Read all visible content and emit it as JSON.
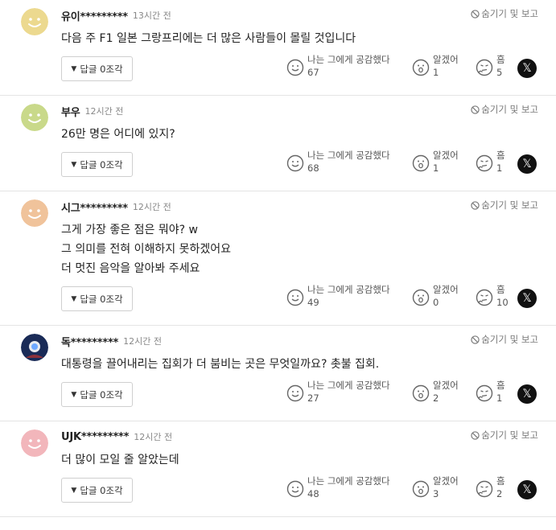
{
  "actions": {
    "hide_label": "숨기기 및 보고",
    "reply_label": "답글 0조각",
    "reaction_sympathy": "나는 그에게 공감했다",
    "reaction_understood": "알겠어",
    "reaction_hmm": "흠",
    "x_label": "𝕏"
  },
  "colors": {
    "avatar_yellow": "#ecd98f",
    "avatar_green": "#c9d98a",
    "avatar_orange": "#f0c39b",
    "avatar_pink": "#f2b6bb",
    "avatar_dark": "#1a2b57"
  },
  "comments": [
    {
      "author": "유이*********",
      "time": "13시간 전",
      "lines": [
        "다음 주 F1 일본 그랑프리에는 더 많은 사람들이 몰릴 것입니다"
      ],
      "sympathy": "67",
      "understood": "1",
      "hmm": "5",
      "avatar": "yellow-smiley-icon"
    },
    {
      "author": "부우",
      "time": "12시간 전",
      "lines": [
        "26만 명은 어디에 있지?"
      ],
      "sympathy": "68",
      "understood": "1",
      "hmm": "1",
      "avatar": "green-smiley-icon"
    },
    {
      "author": "시그*********",
      "time": "12시간 전",
      "lines": [
        "그게 가장 좋은 점은 뭐야? w",
        "그 의미를 전혀 이해하지 못하겠어요",
        "더 멋진 음악을 알아봐 주세요"
      ],
      "sympathy": "49",
      "understood": "0",
      "hmm": "10",
      "avatar": "orange-smiley-icon"
    },
    {
      "author": "독*********",
      "time": "12시간 전",
      "lines": [
        "대통령을 끌어내리는 집회가 더 붐비는 곳은 무엇일까요? 촛불 집회."
      ],
      "sympathy": "27",
      "understood": "2",
      "hmm": "1",
      "avatar": "photo-avatar-icon"
    },
    {
      "author": "UJK*********",
      "time": "12시간 전",
      "lines": [
        "더 많이 모일 줄 알았는데"
      ],
      "sympathy": "48",
      "understood": "3",
      "hmm": "2",
      "avatar": "pink-smiley-icon"
    }
  ]
}
